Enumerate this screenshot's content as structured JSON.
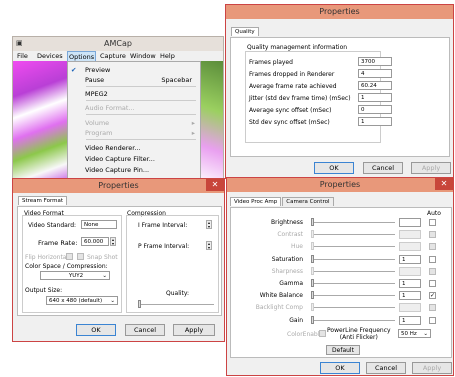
{
  "amcap": {
    "title": "AMCap",
    "menu": [
      "File",
      "Devices",
      "Options",
      "Capture",
      "Window",
      "Help"
    ],
    "options_menu": [
      {
        "label": "Preview",
        "checked": true,
        "shortcut": "",
        "disabled": false,
        "arrow": false
      },
      {
        "label": "Pause",
        "checked": false,
        "shortcut": "Spacebar",
        "disabled": false,
        "arrow": false
      },
      {
        "label": "MPEG2",
        "checked": false,
        "shortcut": "",
        "disabled": false,
        "arrow": false
      },
      {
        "label": "Audio Format...",
        "checked": false,
        "shortcut": "",
        "disabled": true,
        "arrow": false
      },
      {
        "label": "Volume",
        "checked": false,
        "shortcut": "",
        "disabled": true,
        "arrow": true
      },
      {
        "label": "Program",
        "checked": false,
        "shortcut": "",
        "disabled": true,
        "arrow": true
      },
      {
        "label": "Video Renderer...",
        "checked": false,
        "shortcut": "",
        "disabled": false,
        "arrow": false
      },
      {
        "label": "Video Capture Filter...",
        "checked": false,
        "shortcut": "",
        "disabled": false,
        "arrow": false
      },
      {
        "label": "Video Capture Pin...",
        "checked": false,
        "shortcut": "",
        "disabled": false,
        "arrow": false
      }
    ]
  },
  "quality": {
    "title": "Properties",
    "tab": "Quality",
    "heading": "Quality management information",
    "rows": [
      {
        "label": "Frames played",
        "value": "3700"
      },
      {
        "label": "Frames dropped in Renderer",
        "value": "4"
      },
      {
        "label": "Average frame rate achieved",
        "value": "60.24"
      },
      {
        "label": "Jitter (std dev frame time) (mSec)",
        "value": "1"
      },
      {
        "label": "Average sync offset (mSec)",
        "value": "0"
      },
      {
        "label": "Std dev sync offset (mSec)",
        "value": "1"
      }
    ],
    "ok": "OK",
    "cancel": "Cancel",
    "apply": "Apply"
  },
  "stream": {
    "title": "Properties",
    "tab": "Stream Format",
    "video_format": "Video Format",
    "video_standard_label": "Video Standard:",
    "video_standard_value": "None",
    "frame_rate_label": "Frame Rate:",
    "frame_rate_value": "60.000",
    "flip_horizontal": "Flip Horizontal:",
    "snap_shot": "Snap Shot",
    "color_space_label": "Color Space / Compression:",
    "color_space_value": "YUY2",
    "output_size_label": "Output Size:",
    "output_size_value": "640 x 480  (default)",
    "compression": "Compression",
    "iframe_label": "I Frame Interval:",
    "pframe_label": "P Frame Interval:",
    "quality_label": "Quality:",
    "ok": "OK",
    "cancel": "Cancel",
    "apply": "Apply"
  },
  "procamp": {
    "title": "Properties",
    "tabs": [
      "Video Proc Amp",
      "Camera Control"
    ],
    "auto": "Auto",
    "rows": [
      {
        "label": "Brightness",
        "value": "",
        "enabled": true,
        "slider": 0.0,
        "auto_checked": false
      },
      {
        "label": "Contrast",
        "value": "",
        "enabled": false,
        "slider": 0.0,
        "auto_checked": false
      },
      {
        "label": "Hue",
        "value": "",
        "enabled": false,
        "slider": 0.0,
        "auto_checked": false
      },
      {
        "label": "Saturation",
        "value": "1",
        "enabled": true,
        "slider": 0.0,
        "auto_checked": false
      },
      {
        "label": "Sharpness",
        "value": "",
        "enabled": false,
        "slider": 0.0,
        "auto_checked": false
      },
      {
        "label": "Gamma",
        "value": "1",
        "enabled": true,
        "slider": 0.0,
        "auto_checked": false
      },
      {
        "label": "White Balance",
        "value": "1",
        "enabled": true,
        "slider": 0.0,
        "auto_checked": true
      },
      {
        "label": "Backlight Comp",
        "value": "",
        "enabled": false,
        "slider": 0.0,
        "auto_checked": false
      },
      {
        "label": "Gain",
        "value": "1",
        "enabled": true,
        "slider": 0.0,
        "auto_checked": false
      }
    ],
    "color_enable": "ColorEnable",
    "powerline_label": "PowerLine Frequency\n(Anti Flicker)",
    "powerline_line1": "PowerLine Frequency",
    "powerline_line2": "(Anti Flicker)",
    "powerline_value": "50 Hz",
    "default": "Default",
    "ok": "OK",
    "cancel": "Cancel",
    "apply": "Apply"
  }
}
